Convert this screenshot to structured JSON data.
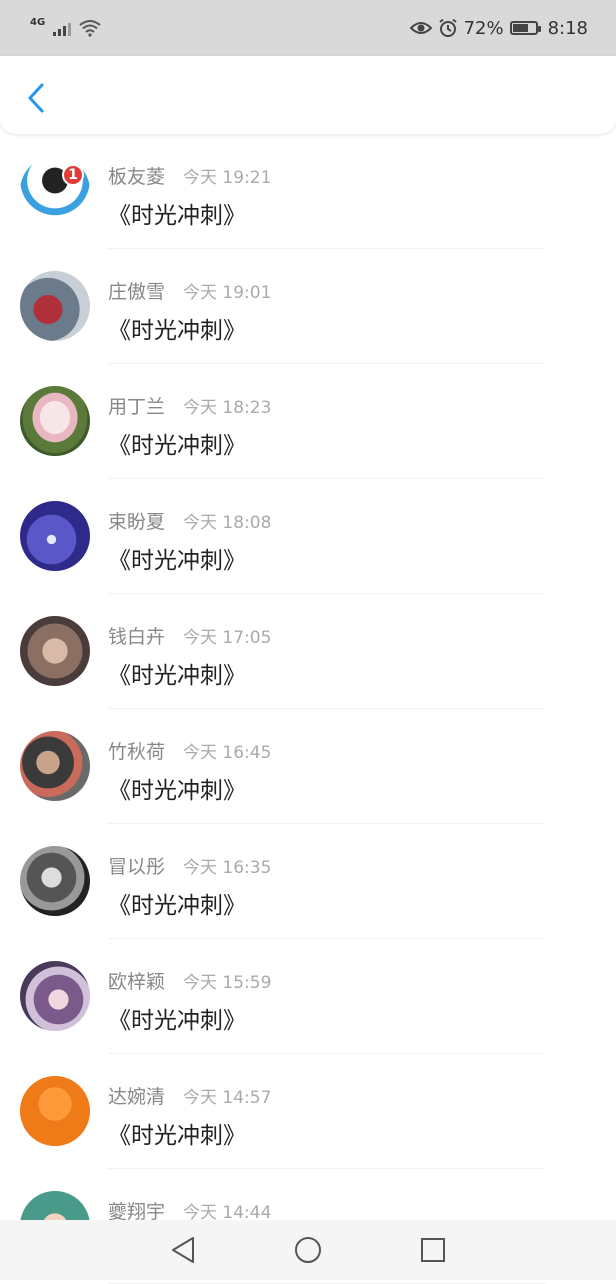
{
  "status_bar": {
    "network": "4G",
    "battery_percent": "72%",
    "battery_level": 0.72,
    "time": "8:18",
    "icons": [
      "signal-icon",
      "wifi-icon",
      "eye-icon",
      "alarm-icon",
      "battery-icon"
    ]
  },
  "header": {
    "back_icon": "chevron-left-icon",
    "accent_color": "#2196f3"
  },
  "messages": [
    {
      "name": "板友菱",
      "time": "今天 19:21",
      "text": "《时光冲刺》",
      "badge": "1"
    },
    {
      "name": "庄傲雪",
      "time": "今天 19:01",
      "text": "《时光冲刺》"
    },
    {
      "name": "用丁兰",
      "time": "今天 18:23",
      "text": "《时光冲刺》"
    },
    {
      "name": "束盼夏",
      "time": "今天 18:08",
      "text": "《时光冲刺》"
    },
    {
      "name": "钱白卉",
      "time": "今天 17:05",
      "text": "《时光冲刺》"
    },
    {
      "name": "竹秋荷",
      "time": "今天 16:45",
      "text": "《时光冲刺》"
    },
    {
      "name": "冒以彤",
      "time": "今天 16:35",
      "text": "《时光冲刺》"
    },
    {
      "name": "欧梓颖",
      "time": "今天 15:59",
      "text": "《时光冲刺》"
    },
    {
      "name": "达婉清",
      "time": "今天 14:57",
      "text": "《时光冲刺》"
    },
    {
      "name": "夔翔宇",
      "time": "今天 14:44",
      "text": ""
    }
  ],
  "nav_bar": {
    "icons": [
      "back-triangle-icon",
      "home-circle-icon",
      "recents-square-icon"
    ]
  }
}
